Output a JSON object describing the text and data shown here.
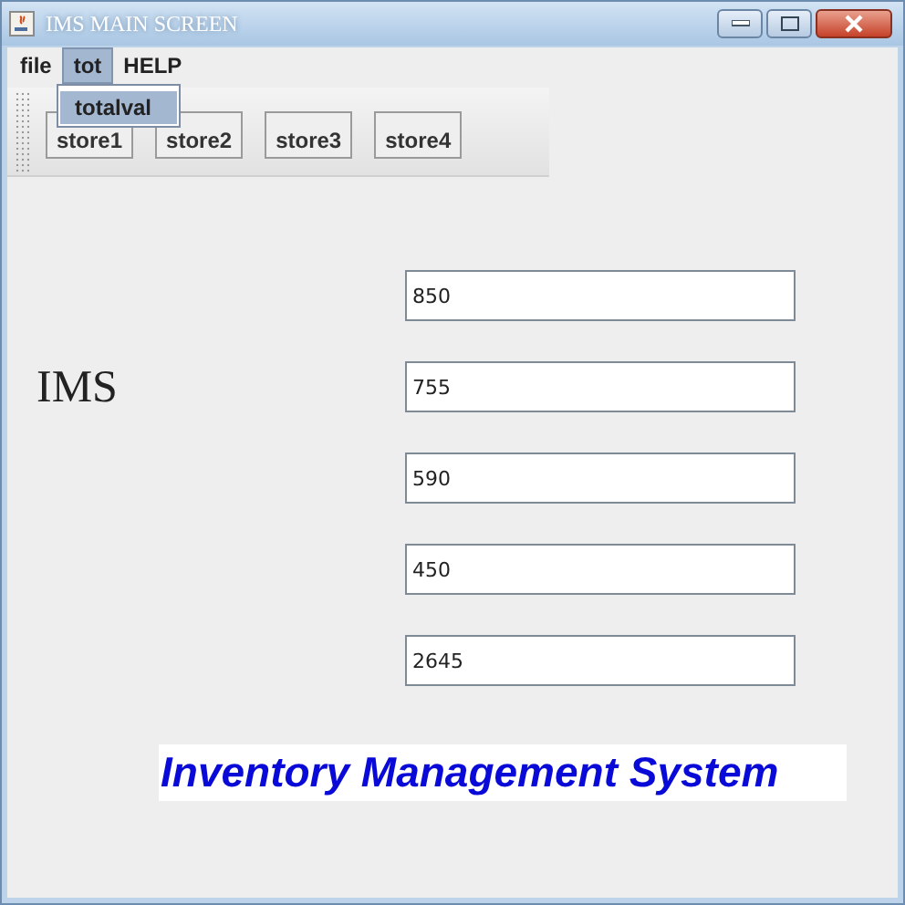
{
  "window": {
    "title": "IMS MAIN SCREEN"
  },
  "menu": [
    {
      "label": "file",
      "selected": false
    },
    {
      "label": "tot",
      "selected": true
    },
    {
      "label": "HELP",
      "selected": false
    }
  ],
  "open_menu": {
    "items": [
      "totalval"
    ]
  },
  "toolbar": {
    "buttons": [
      "store1",
      "store2",
      "store3",
      "store4"
    ]
  },
  "heading": "IMS",
  "fields": [
    {
      "value": "850"
    },
    {
      "value": "755"
    },
    {
      "value": "590"
    },
    {
      "value": "450"
    },
    {
      "value": "2645"
    }
  ],
  "banner": "Inventory Management System"
}
